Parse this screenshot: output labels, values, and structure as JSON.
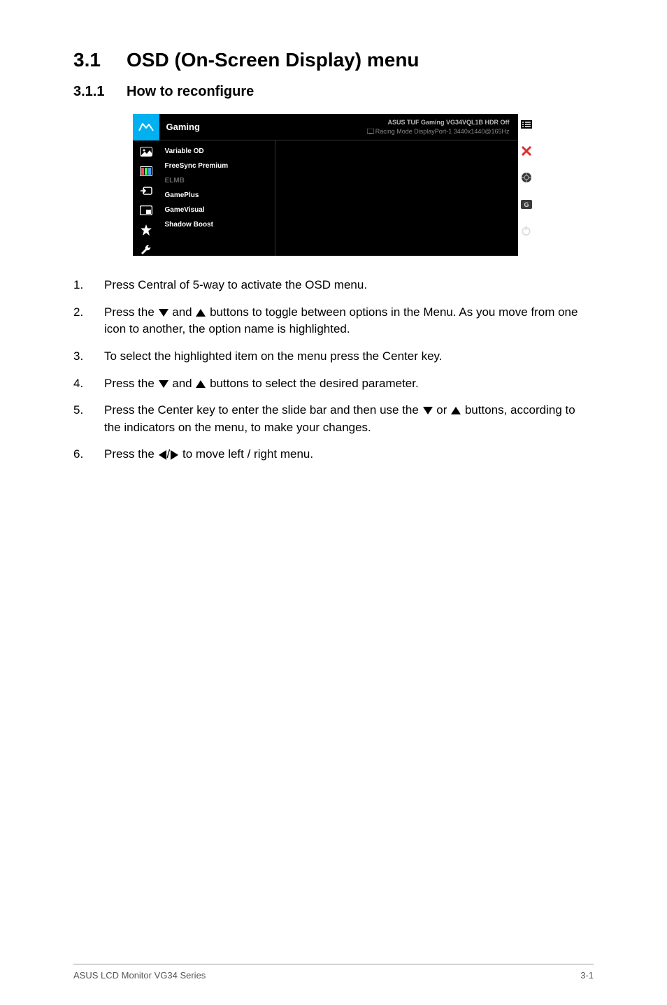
{
  "section": {
    "h1num": "3.1",
    "h1title": "OSD (On-Screen Display) menu",
    "h2num": "3.1.1",
    "h2title": "How to reconfigure"
  },
  "osd": {
    "header_title": "Gaming",
    "header_info_line1": "ASUS TUF Gaming VG34VQL1B  HDR Off",
    "header_info_line2": "Racing Mode DisplayPort-1 3440x1440@165Hz",
    "menu": [
      {
        "label": "Variable OD",
        "disabled": false
      },
      {
        "label": "FreeSync Premium",
        "disabled": false
      },
      {
        "label": "ELMB",
        "disabled": true
      },
      {
        "label": "GamePlus",
        "disabled": false
      },
      {
        "label": "GameVisual",
        "disabled": false
      },
      {
        "label": "Shadow Boost",
        "disabled": false
      }
    ],
    "nav_icons": [
      "image-icon",
      "color-icon",
      "input-icon",
      "pip-icon",
      "star-icon",
      "wrench-icon"
    ],
    "right_icons": [
      "menu-list-icon",
      "close-icon",
      "crosshair-icon",
      "gamevisual-icon",
      "power-icon"
    ],
    "right_letter": "G"
  },
  "steps": {
    "s1n": "1.",
    "s1": "Press Central of 5-way to activate the OSD menu.",
    "s2n": "2.",
    "s2a": "Press the ",
    "s2b": " and ",
    "s2c": " buttons to toggle between options in the Menu. As you move from one icon to another, the option name is highlighted.",
    "s3n": "3.",
    "s3": "To select the highlighted item on the menu press the Center key.",
    "s4n": "4.",
    "s4a": "Press the ",
    "s4b": " and ",
    "s4c": " buttons to select the desired parameter.",
    "s5n": "5.",
    "s5a": "Press the Center key to enter the slide bar and then use the ",
    "s5b": " or ",
    "s5c": " buttons, according to the indicators on the menu, to make your changes.",
    "s6n": "6.",
    "s6a": "Press the ",
    "s6b": "/",
    "s6c": " to move left / right menu."
  },
  "footer": {
    "left": "ASUS LCD Monitor VG34 Series",
    "right": "3-1"
  }
}
